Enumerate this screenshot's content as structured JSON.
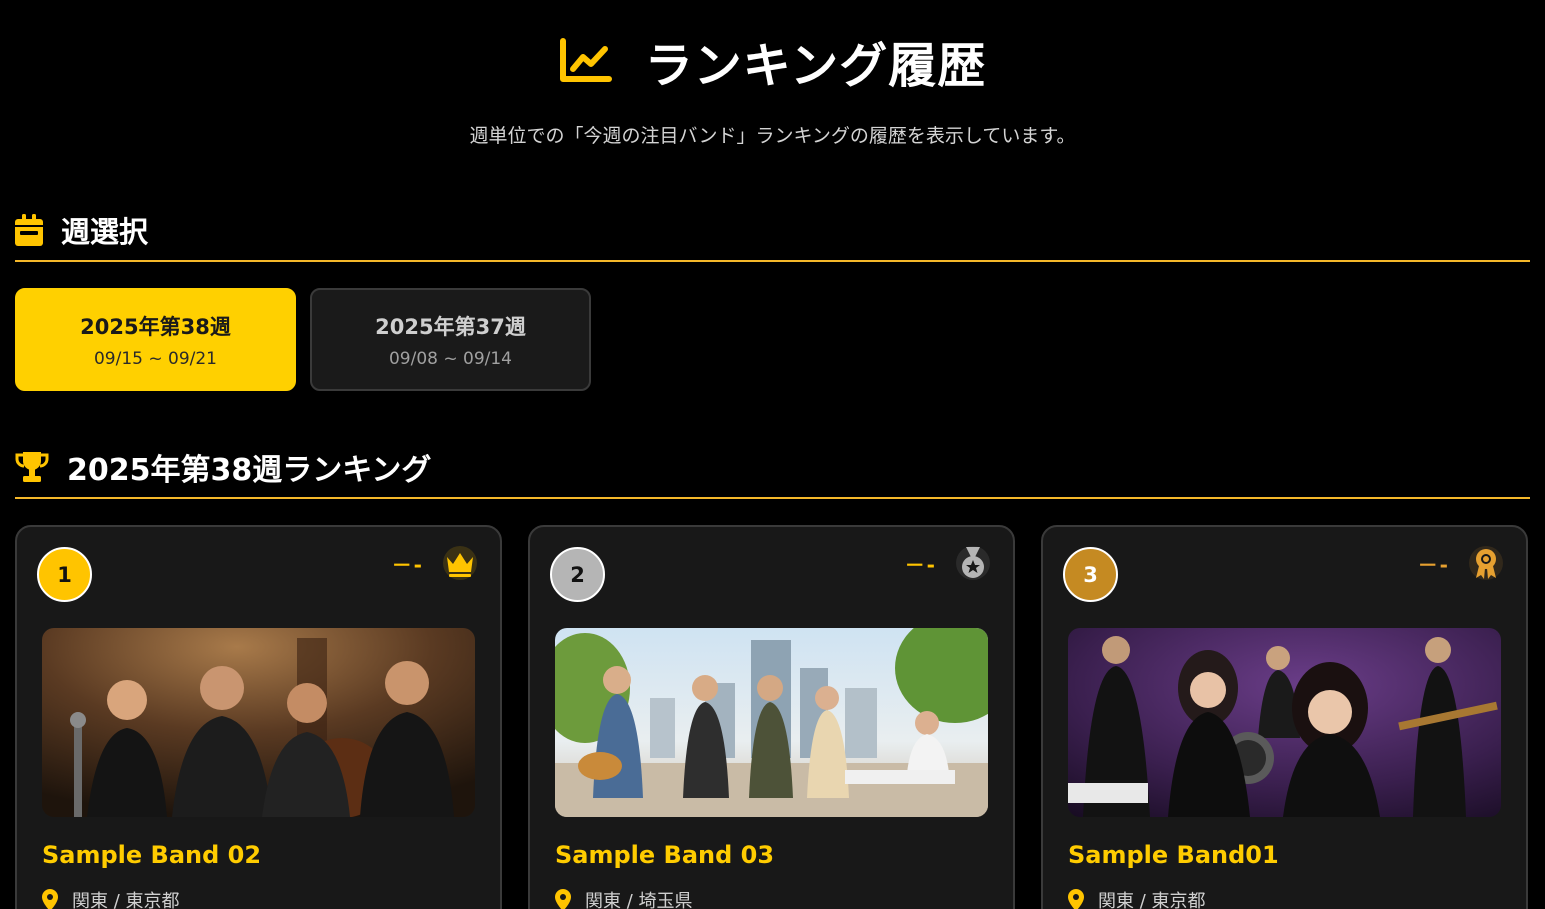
{
  "header": {
    "title": "ランキング履歴",
    "subtitle": "週単位での「今週の注目バンド」ランキングの履歴を表示しています。",
    "icon": "chart-line-icon",
    "accent": "#ffc400"
  },
  "week_section": {
    "title": "週選択",
    "icon": "calendar-icon",
    "weeks": [
      {
        "title": "2025年第38週",
        "range": "09/15 ~ 09/21",
        "active": true
      },
      {
        "title": "2025年第37週",
        "range": "09/08 ~ 09/14",
        "active": false
      }
    ]
  },
  "ranking_section": {
    "title": "2025年第38週ランキング",
    "icon": "trophy-icon",
    "cards": [
      {
        "rank": "1",
        "trend": "－-",
        "medal": "crown-icon",
        "name": "Sample Band 02",
        "location": "関東 / 東京都"
      },
      {
        "rank": "2",
        "trend": "－-",
        "medal": "silver-medal-icon",
        "name": "Sample Band 03",
        "location": "関東 / 埼玉県"
      },
      {
        "rank": "3",
        "trend": "－-",
        "medal": "bronze-award-icon",
        "name": "Sample Band01",
        "location": "関東 / 東京都"
      }
    ]
  },
  "colors": {
    "background": "#000000",
    "gold": "#ffc400",
    "silver": "#b5b5b5",
    "bronze": "#c58a22",
    "divider": "#f5b82a",
    "card": "#181818"
  }
}
